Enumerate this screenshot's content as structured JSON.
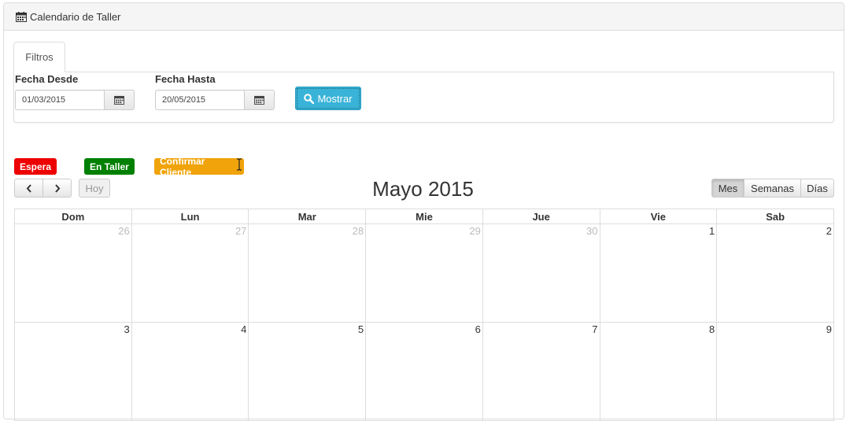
{
  "header": {
    "title": "Calendario de Taller",
    "icon": "calendar-icon"
  },
  "tabs": [
    {
      "label": "Filtros"
    }
  ],
  "filters": {
    "from_label": "Fecha Desde",
    "from_value": "01/03/2015",
    "to_label": "Fecha Hasta",
    "to_value": "20/05/2015",
    "show_button": "Mostrar"
  },
  "legend": [
    {
      "label": "Espera",
      "color": "#ee0000"
    },
    {
      "label": "En Taller",
      "color": "#008000"
    },
    {
      "label": "Confirmar Cliente",
      "color": "#f0a30a"
    }
  ],
  "calendar": {
    "title": "Mayo 2015",
    "today_label": "Hoy",
    "views": [
      "Mes",
      "Semanas",
      "Días"
    ],
    "active_view": "Mes",
    "weekdays": [
      "Dom",
      "Lun",
      "Mar",
      "Mie",
      "Jue",
      "Vie",
      "Sab"
    ],
    "weeks": [
      [
        {
          "d": "26",
          "other": true
        },
        {
          "d": "27",
          "other": true
        },
        {
          "d": "28",
          "other": true
        },
        {
          "d": "29",
          "other": true
        },
        {
          "d": "30",
          "other": true
        },
        {
          "d": "1"
        },
        {
          "d": "2"
        }
      ],
      [
        {
          "d": "3"
        },
        {
          "d": "4"
        },
        {
          "d": "5"
        },
        {
          "d": "6"
        },
        {
          "d": "7"
        },
        {
          "d": "8"
        },
        {
          "d": "9"
        }
      ]
    ]
  }
}
